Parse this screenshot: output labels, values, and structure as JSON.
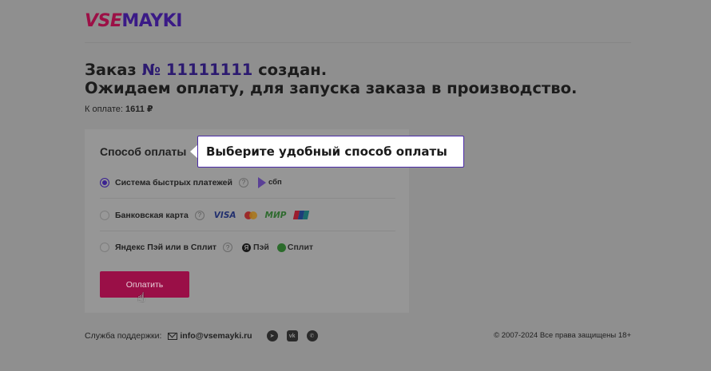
{
  "logo": {
    "part1": "VSE",
    "part2": "MAYKI"
  },
  "order": {
    "line1_prefix": "Заказ ",
    "number": "№ 11111111",
    "line1_suffix": " создан.",
    "line2": "Ожидаем оплату, для запуска заказа в производство."
  },
  "amount": {
    "label": "К оплате: ",
    "value": "1611 ₽"
  },
  "payment": {
    "title": "Способ оплаты",
    "options": [
      {
        "label": "Система быстрых платежей",
        "selected": true,
        "brands": [
          "сбп"
        ]
      },
      {
        "label": "Банковская карта",
        "selected": false,
        "brands": [
          "VISA",
          "mastercard",
          "МИР",
          "unionpay"
        ]
      },
      {
        "label": "Яндекс Пэй или в Сплит",
        "selected": false,
        "brands": [
          "Пэй",
          "Сплит"
        ]
      }
    ],
    "help_glyph": "?",
    "button": "Оплатить"
  },
  "tooltip": "Выберите удобный способ оплаты",
  "footer": {
    "support_label": "Служба поддержки:",
    "email": "info@vsemayki.ru",
    "socials": [
      "telegram-icon",
      "vk-icon",
      "whatsapp-icon"
    ],
    "copyright": "© 2007-2024 Все права защищены 18+"
  },
  "colors": {
    "brand_red": "#9a0f47",
    "brand_purple": "#3a1a86",
    "overlay": "#8f8f8f"
  }
}
